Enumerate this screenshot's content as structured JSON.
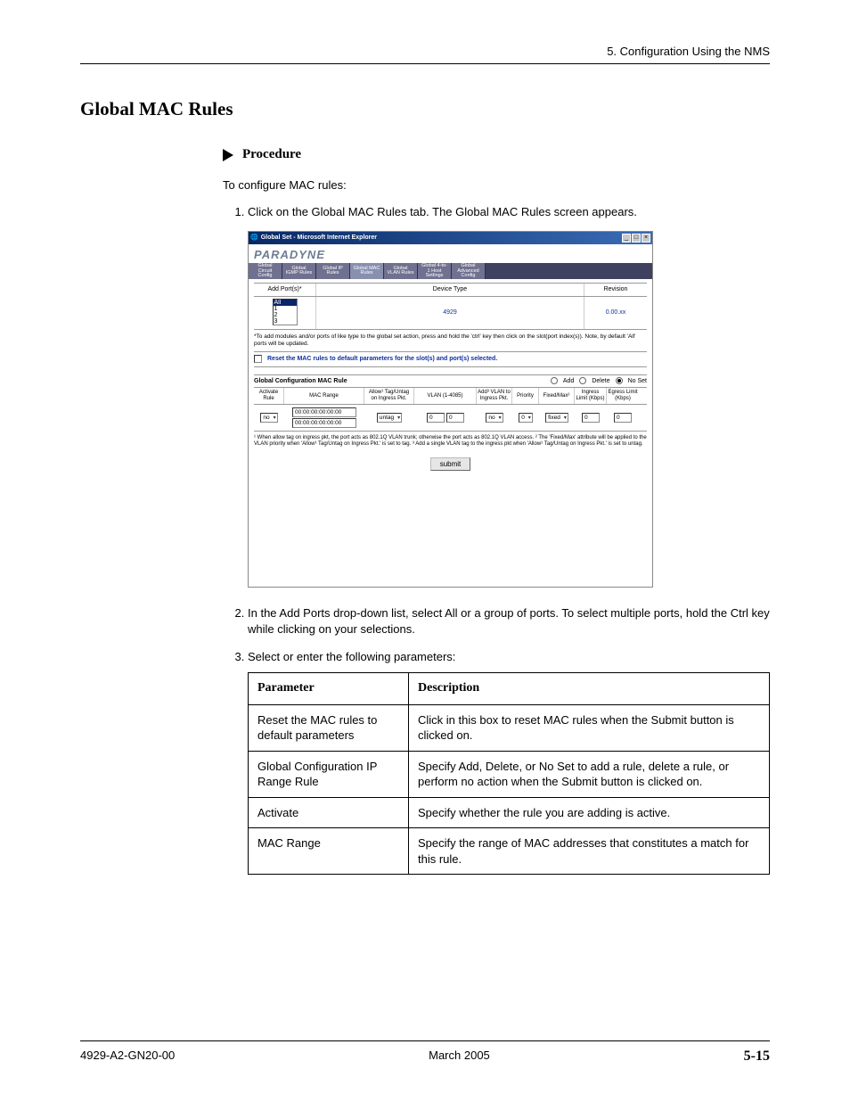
{
  "header": {
    "chapter": "5. Configuration Using the NMS"
  },
  "section_title": "Global MAC Rules",
  "procedure": {
    "heading": "Procedure",
    "intro": "To configure MAC rules:",
    "steps": [
      "Click on the Global MAC Rules tab. The Global MAC Rules screen appears.",
      "In the Add Ports drop-down list, select All or a group of ports. To select multiple ports, hold the Ctrl key while clicking on your selections.",
      "Select or enter the following parameters:"
    ]
  },
  "screenshot": {
    "window_title": "Global Set - Microsoft Internet Explorer",
    "brand": "PARADYNE",
    "tabs": [
      "Global Circuit Config",
      "Global IGMP Rules",
      "Global IP Rules",
      "Global MAC Rules",
      "Global VLAN Rules",
      "Global 4-to-1 Host Settings",
      "Global Advanced Config"
    ],
    "active_tab_index": 3,
    "row_headers": {
      "add_ports": "Add Port(s)*",
      "device_type": "Device Type",
      "revision": "Revision"
    },
    "port_options": [
      "All",
      "1",
      "2",
      "3"
    ],
    "device_type_value": "4929",
    "revision_value": "0.00.xx",
    "note_ports": "*To add modules and/or ports of like type to the global set action, press and hold the 'ctrl' key then click on the slot(port index(s)). Note, by default 'All' ports will be updated.",
    "reset_text": "Reset the MAC rules to default parameters for the slot(s) and port(s) selected.",
    "gcfg_title": "Global Configuration MAC Rule",
    "radios": {
      "add": "Add",
      "delete": "Delete",
      "noset": "No Set"
    },
    "columns": {
      "activate": "Activate Rule",
      "mac_range": "MAC Range",
      "allow": "Allow¹ Tag/Untag on Ingress Pkt.",
      "vlan": "VLAN (1-4085)",
      "addvlan": "Add³ VLAN to Ingress Pkt.",
      "priority": "Priority",
      "fixedmax": "Fixed/Max²",
      "ingress": "Ingress Limit (Kbps)",
      "egress": "Egress Limit (Kbps)"
    },
    "values": {
      "activate": "no",
      "mac1": "00:00:00:00:00:00",
      "mac2": "00:00:00:00:00:00",
      "allow": "untag",
      "vlan1": "0",
      "vlan2": "0",
      "addvlan": "no",
      "priority": "0",
      "fixedmax": "fixed",
      "ingress": "0",
      "egress": "0"
    },
    "footnotes": "¹ When allow tag on ingress pkt, the port acts as 802.1Q VLAN trunk; otherwise the port acts as 802.1Q VLAN access. ² The 'Fixed/Max' attribute will be applied to the VLAN priority when 'Allow¹ Tag/Untag on Ingress Pkt.' is set to tag. ³ Add a single VLAN tag to the ingress pkt when 'Allow¹ Tag/Untag on Ingress Pkt.' is set to untag.",
    "submit": "submit"
  },
  "param_table": {
    "head": {
      "param": "Parameter",
      "desc": "Description"
    },
    "rows": [
      {
        "param": "Reset the MAC rules to default parameters",
        "desc": "Click in this box to reset MAC rules when the Submit button is clicked on."
      },
      {
        "param": "Global Configuration IP Range Rule",
        "desc": "Specify Add, Delete, or No Set to add a rule, delete a rule, or perform no action when the Submit button is clicked on."
      },
      {
        "param": "Activate",
        "desc": "Specify whether the rule you are adding is active."
      },
      {
        "param": "MAC Range",
        "desc": "Specify the range of MAC addresses that constitutes a match for this rule."
      }
    ]
  },
  "footer": {
    "docno": "4929-A2-GN20-00",
    "date": "March 2005",
    "page": "5-15"
  }
}
